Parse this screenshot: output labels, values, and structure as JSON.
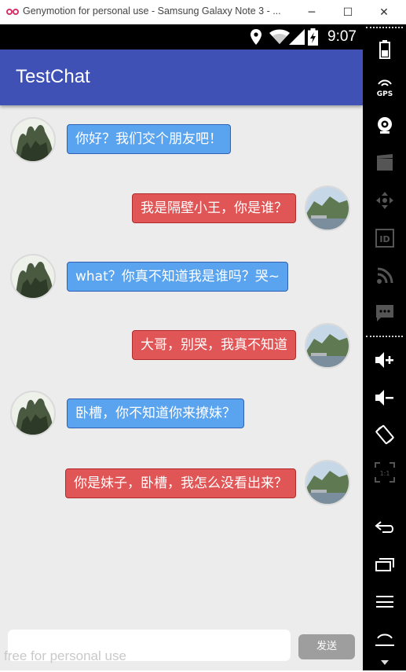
{
  "window": {
    "title": "Genymotion for personal use - Samsung Galaxy Note 3 - ...",
    "minimize_glyph": "─",
    "maximize_glyph": "☐",
    "close_glyph": "✕"
  },
  "status_bar": {
    "time": "9:07"
  },
  "app_bar": {
    "title": "TestChat"
  },
  "messages": [
    {
      "side": "left",
      "text": "你好？我们交个朋友吧！"
    },
    {
      "side": "right",
      "text": "我是隔壁小王，你是谁？"
    },
    {
      "side": "left",
      "text": "what？你真不知道我是谁吗？哭~"
    },
    {
      "side": "right",
      "text": "大哥，别哭，我真不知道"
    },
    {
      "side": "left",
      "text": "卧槽，你不知道你来撩妹？"
    },
    {
      "side": "right",
      "text": "你是妹子，卧槽，我怎么没看出来？"
    }
  ],
  "composer": {
    "input_value": "",
    "send_label": "发送"
  },
  "watermark": "free for personal use",
  "toolbar": {
    "icons": [
      "battery-icon",
      "gps-icon",
      "camera-icon",
      "video-icon",
      "dpad-icon",
      "id-icon",
      "rss-icon",
      "sms-icon",
      "volume-up-icon",
      "volume-down-icon",
      "rotate-icon",
      "scale-icon",
      "back-icon",
      "recents-icon",
      "menu-icon",
      "home-icon"
    ],
    "gps_label": "GPS",
    "id_label": "ID",
    "scale_label": "1:1"
  },
  "colors": {
    "app_bar": "#3f51b5",
    "bubble_left": "#5aa4ef",
    "bubble_right": "#e05555",
    "chat_background": "#ececec"
  }
}
